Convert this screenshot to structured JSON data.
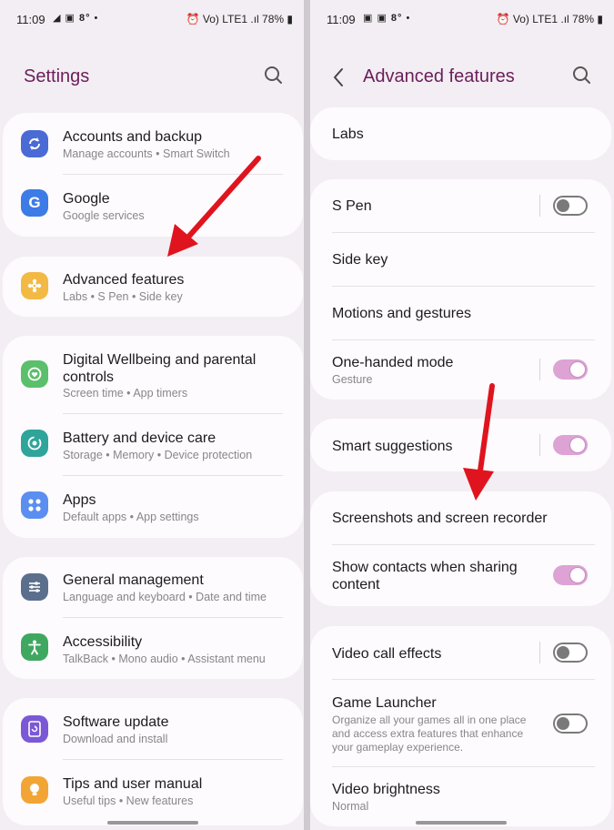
{
  "colors": {
    "accent": "#6b1e5a",
    "arrow": "#e0141e",
    "toggle_on": "#dca3d4"
  },
  "status_left": {
    "time": "11:09",
    "temp": "8°",
    "right": "Vo) LTE1 .ıl 78%"
  },
  "status_right": {
    "time": "11:09",
    "temp": "8°",
    "right": "Vo) LTE1 .ıl 78%"
  },
  "left": {
    "title": "Settings",
    "items": [
      {
        "title": "Accounts and backup",
        "sub": "Manage accounts  •  Smart Switch",
        "icon": "sync-icon",
        "color": "#4a6bd5"
      },
      {
        "title": "Google",
        "sub": "Google services",
        "icon": "google-icon",
        "color": "#3d7be6"
      },
      {
        "title": "Advanced features",
        "sub": "Labs  •  S Pen  •  Side key",
        "icon": "advanced-features-icon",
        "color": "#f2b944"
      },
      {
        "title": "Digital Wellbeing and parental",
        "title2": "controls",
        "sub": "Screen time  •  App timers",
        "icon": "wellbeing-icon",
        "color": "#5bbf6b"
      },
      {
        "title": "Battery and device care",
        "sub": "Storage  •  Memory  •  Device protection",
        "icon": "device-care-icon",
        "color": "#2fa49a"
      },
      {
        "title": "Apps",
        "sub": "Default apps  •  App settings",
        "icon": "apps-icon",
        "color": "#5b8ef0"
      },
      {
        "title": "General management",
        "sub": "Language and keyboard  •  Date and time",
        "icon": "sliders-icon",
        "color": "#5b6f8c"
      },
      {
        "title": "Accessibility",
        "sub": "TalkBack  •  Mono audio  •  Assistant menu",
        "icon": "accessibility-icon",
        "color": "#3fa860"
      },
      {
        "title": "Software update",
        "sub": "Download and install",
        "icon": "software-update-icon",
        "color": "#7b58d6"
      },
      {
        "title": "Tips and user manual",
        "sub": "Useful tips  •  New features",
        "icon": "lightbulb-icon",
        "color": "#f2a534"
      }
    ]
  },
  "right": {
    "title": "Advanced features",
    "items": [
      {
        "title": "Labs"
      },
      {
        "title": "S Pen",
        "toggle": "off"
      },
      {
        "title": "Side key"
      },
      {
        "title": "Motions and gestures"
      },
      {
        "title": "One-handed mode",
        "sub": "Gesture",
        "toggle": "on"
      },
      {
        "title": "Smart suggestions",
        "toggle": "on"
      },
      {
        "title": "Screenshots and screen recorder"
      },
      {
        "title": "Show contacts when sharing",
        "title2": "content",
        "toggle": "on"
      },
      {
        "title": "Video call effects",
        "toggle": "off"
      },
      {
        "title": "Game Launcher",
        "desc1": "Organize all your games all in one place",
        "desc2": "and access extra features that enhance",
        "desc3": "your gameplay experience.",
        "toggle": "off"
      },
      {
        "title": "Video brightness",
        "sub": "Normal"
      }
    ]
  }
}
